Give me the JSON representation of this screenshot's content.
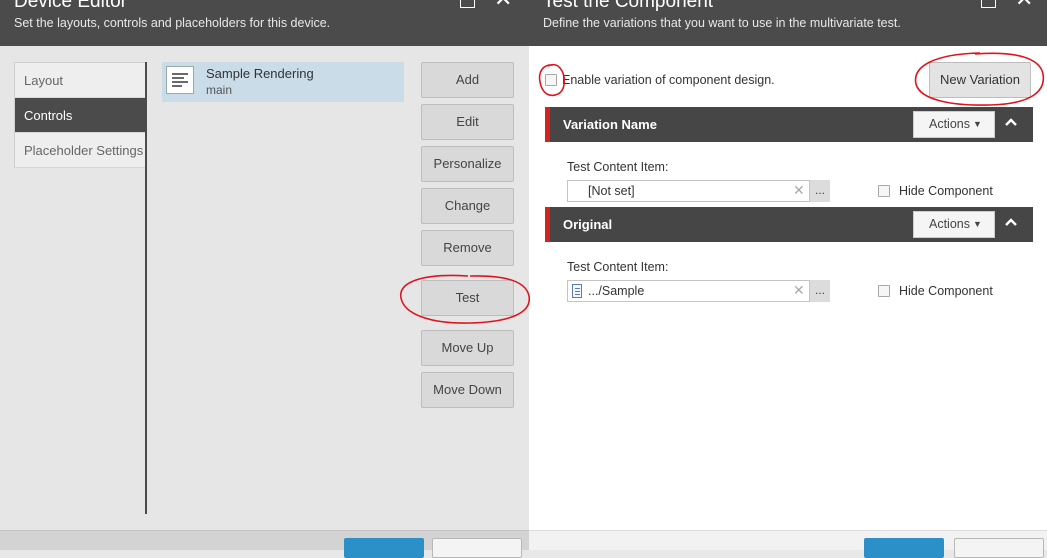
{
  "left_dialog": {
    "title": "Device Editor",
    "subtitle": "Set the layouts, controls and placeholders for this device.",
    "tabs": [
      {
        "label": "Layout"
      },
      {
        "label": "Controls"
      },
      {
        "label": "Placeholder Settings"
      }
    ],
    "active_tab": "Controls",
    "rendering": {
      "name": "Sample Rendering",
      "placeholder": "main"
    },
    "buttons": {
      "add": "Add",
      "edit": "Edit",
      "personalize": "Personalize",
      "change": "Change",
      "remove": "Remove",
      "test": "Test",
      "move_up": "Move Up",
      "move_down": "Move Down"
    }
  },
  "right_dialog": {
    "title": "Test the Component",
    "subtitle": "Define the variations that you want to use in the multivariate test.",
    "enable_label": "Enable variation of component design.",
    "new_variation": "New Variation",
    "variations": [
      {
        "name": "Variation Name",
        "actions": "Actions",
        "content_label": "Test Content Item:",
        "content_value": "[Not set]",
        "hide_label": "Hide Component",
        "browse": "..."
      },
      {
        "name": "Original",
        "actions": "Actions",
        "content_label": "Test Content Item:",
        "content_value": ".../Sample",
        "hide_label": "Hide Component",
        "browse": "..."
      }
    ]
  },
  "colors": {
    "header": "#4b4b4b",
    "accent_red": "#d3231d",
    "selected_row": "#c9dce8",
    "primary_button": "#2b8fc8"
  },
  "icons": [
    "maximize-icon",
    "close-icon",
    "rendering-icon",
    "caret-down-icon",
    "chevron-up-icon",
    "clear-icon",
    "document-icon"
  ]
}
